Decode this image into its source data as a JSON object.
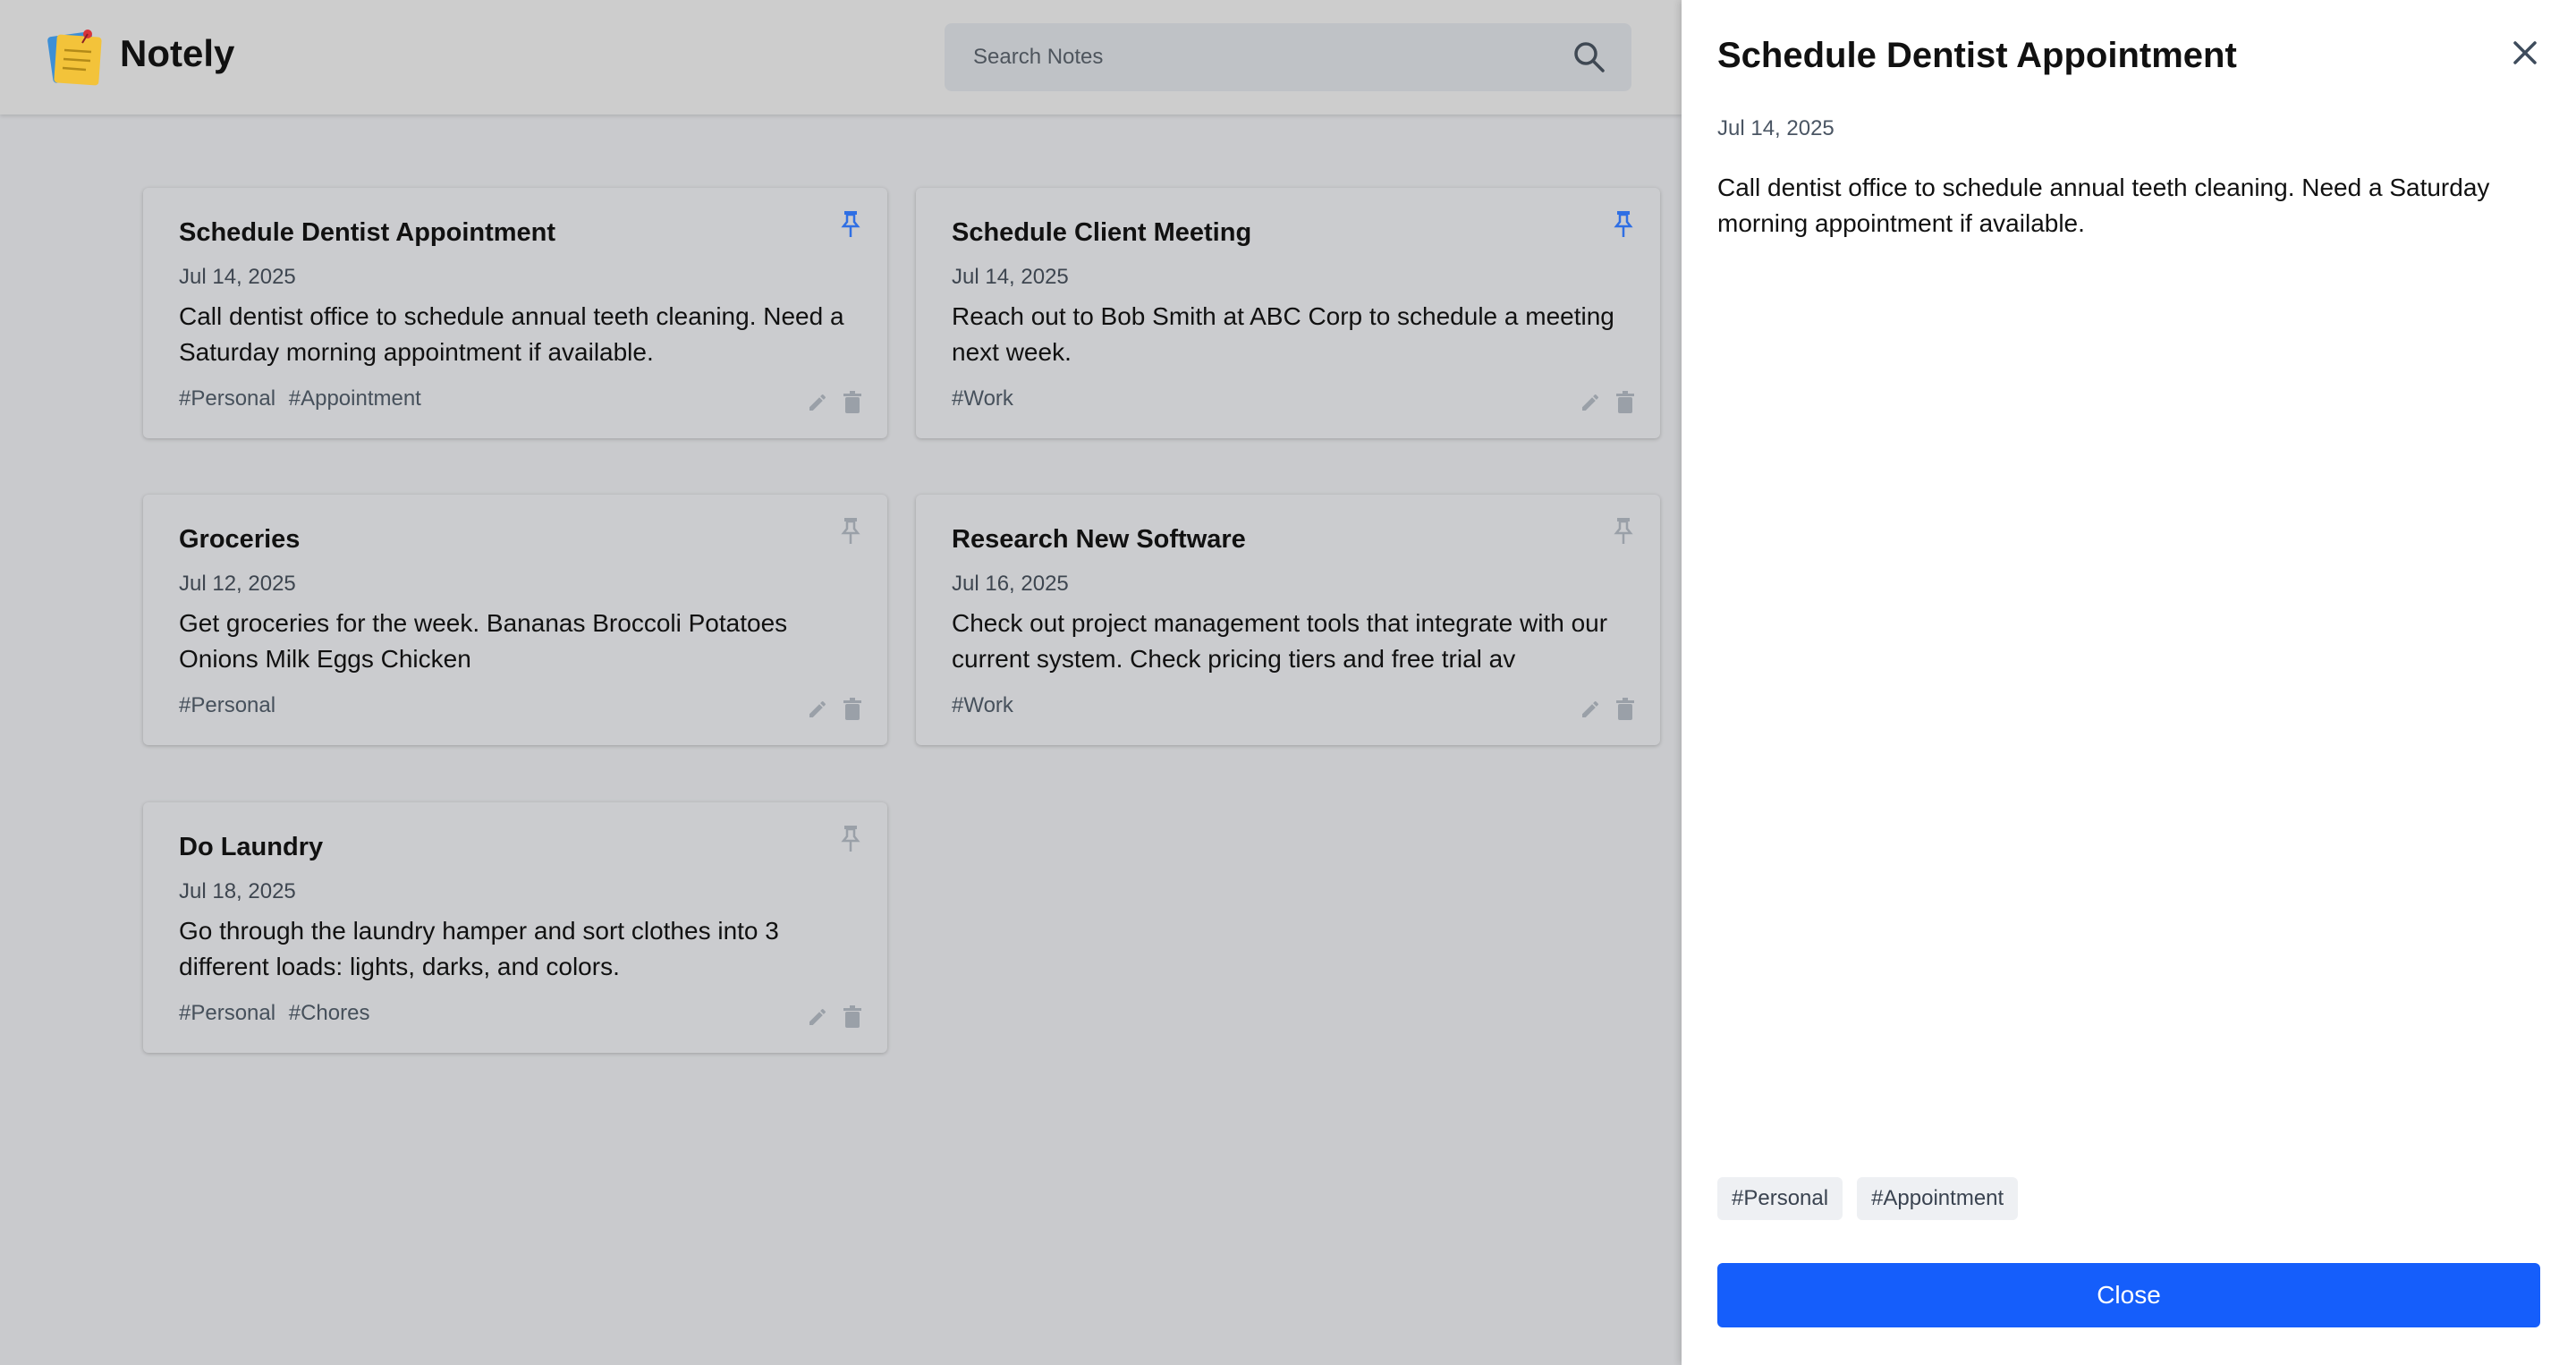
{
  "app": {
    "title": "Notely"
  },
  "search": {
    "placeholder": "Search Notes"
  },
  "notes": [
    {
      "title": "Schedule Dentist Appointment",
      "date": "Jul 14, 2025",
      "body": "Call dentist office to schedule annual teeth cleaning. Need a Saturday morning appointment if available.",
      "tags": [
        "#Personal",
        "#Appointment"
      ],
      "pinned": true
    },
    {
      "title": "Schedule Client Meeting",
      "date": "Jul 14, 2025",
      "body": "Reach out to Bob Smith at ABC Corp to schedule a meeting next week.",
      "tags": [
        "#Work"
      ],
      "pinned": true
    },
    {
      "title": "Groceries",
      "date": "Jul 12, 2025",
      "body": "Get groceries for the week. Bananas Broccoli Potatoes Onions Milk Eggs Chicken",
      "tags": [
        "#Personal"
      ],
      "pinned": false
    },
    {
      "title": "Research New Software",
      "date": "Jul 16, 2025",
      "body": "Check out project management tools that integrate with our current system. Check pricing tiers and free trial av",
      "tags": [
        "#Work"
      ],
      "pinned": false
    },
    {
      "title": "Do Laundry",
      "date": "Jul 18, 2025",
      "body": "Go through the laundry hamper and sort clothes into 3 different loads: lights, darks, and colors.",
      "tags": [
        "#Personal",
        "#Chores"
      ],
      "pinned": false
    }
  ],
  "detail": {
    "title": "Schedule Dentist Appointment",
    "date": "Jul 14, 2025",
    "body": "Call dentist office to schedule annual teeth cleaning. Need a Saturday morning appointment if available.",
    "tags": [
      "#Personal",
      "#Appointment"
    ],
    "close_label": "Close"
  },
  "icons": {
    "logo": "sticky-note-logo-icon",
    "search": "search-icon",
    "pin": "pin-icon",
    "edit": "pencil-icon",
    "delete": "trash-icon",
    "close": "close-icon"
  },
  "colors": {
    "accent": "#155efb",
    "pin_active": "#2f6fe4",
    "pin_inactive": "#9aa0a8",
    "overlay_bg": "#c9cacd",
    "panel_bg": "#ffffff"
  }
}
